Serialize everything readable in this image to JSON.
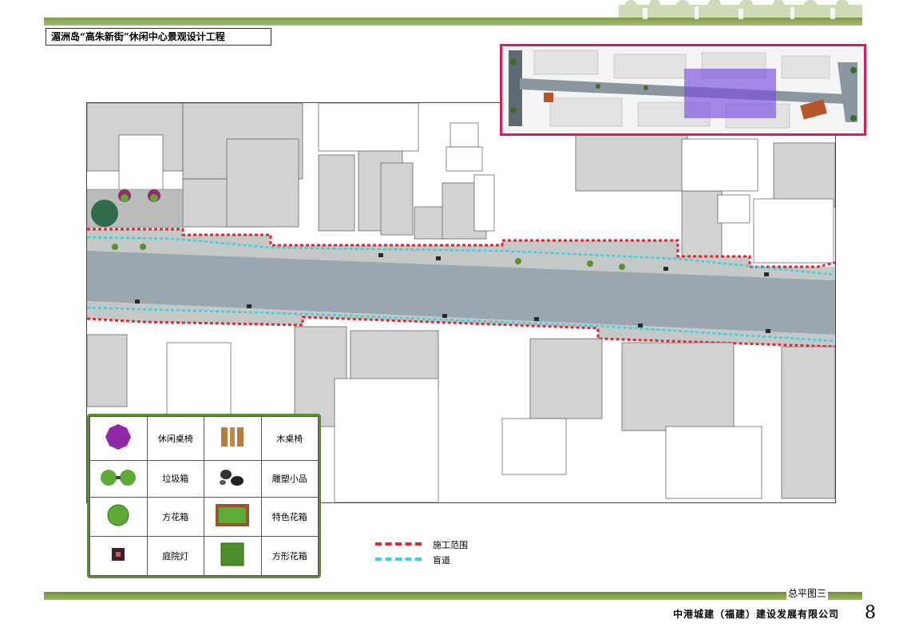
{
  "project_title": "湄洲岛“高朱新街”休闲中心景观设计工程",
  "drawing_title": "总平图三",
  "company": "中港城建（福建）建设发展有限公司",
  "page_number": "8",
  "legend_items": [
    {
      "symbol": "umbrella-table-icon",
      "label": "休闲桌椅"
    },
    {
      "symbol": "wooden-bench-icon",
      "label": "木桌椅"
    },
    {
      "symbol": "trash-bin-icon",
      "label": "垃圾箱"
    },
    {
      "symbol": "sculpture-icon",
      "label": "雕塑小品"
    },
    {
      "symbol": "round-planter-icon",
      "label": "方花箱"
    },
    {
      "symbol": "feature-planter-icon",
      "label": "特色花箱"
    },
    {
      "symbol": "courtyard-lamp-icon",
      "label": "庭院灯"
    },
    {
      "symbol": "square-planter-icon",
      "label": "方形花箱"
    }
  ],
  "line_legend": [
    {
      "label": "施工范围",
      "color": "#e3262f"
    },
    {
      "label": "盲道",
      "color": "#3ad0e0"
    }
  ],
  "colors": {
    "frame_green": "#5b8a2f",
    "key_map_border": "#d0215a",
    "road": "#9aa6b0",
    "building": "#d2d2d2",
    "sidewalk": "#c4c8c6",
    "highlight": "#7a4fe0"
  }
}
